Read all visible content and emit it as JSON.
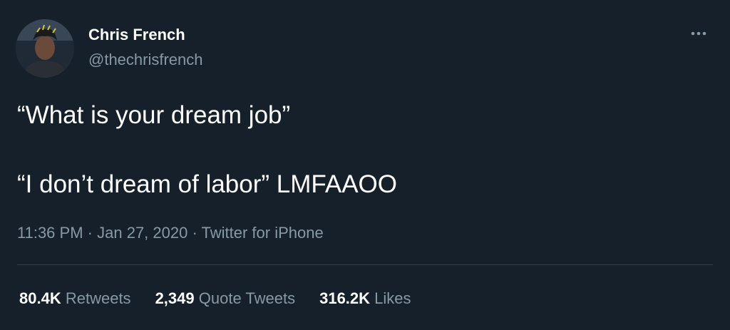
{
  "tweet": {
    "author": {
      "name": "Chris French",
      "handle": "@thechrisfrench"
    },
    "text_lines": [
      "“What is your dream job”",
      "“I don’t dream of labor” LMFAAOO"
    ],
    "time": "11:36 PM",
    "date": "Jan 27, 2020",
    "source": "Twitter for iPhone",
    "separator": "·",
    "stats": {
      "retweets_count": "80.4K",
      "retweets_label": "Retweets",
      "quote_tweets_count": "2,349",
      "quote_tweets_label": "Quote Tweets",
      "likes_count": "316.2K",
      "likes_label": "Likes"
    }
  },
  "icons": {
    "more": "more-horizontal-icon"
  },
  "colors": {
    "background": "#15202b",
    "text_primary": "#ffffff",
    "text_secondary": "#8899a6",
    "divider": "#38444d"
  }
}
